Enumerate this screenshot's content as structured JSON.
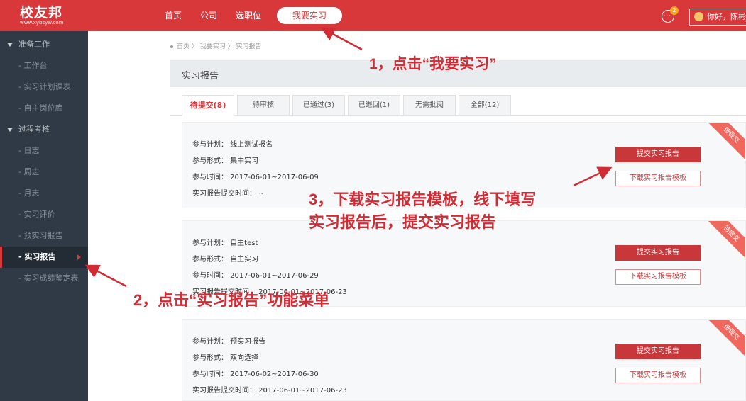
{
  "logo": {
    "main": "校友邦",
    "sub": "www.xybsyw.com"
  },
  "nav": {
    "items": [
      "首页",
      "公司",
      "选职位"
    ],
    "active": "我要实习"
  },
  "header_right": {
    "msg_badge": "2",
    "user_greeting": "你好，陈彬"
  },
  "sidebar": {
    "groups": [
      {
        "label": "准备工作",
        "items": [
          "- 工作台",
          "- 实习计划课表",
          "- 自主岗位库"
        ]
      },
      {
        "label": "过程考核",
        "items": [
          "- 日志",
          "- 周志",
          "- 月志",
          "- 实习评价",
          "- 预实习报告",
          "- 实习报告",
          "- 实习成绩鉴定表"
        ]
      }
    ],
    "active_item": "- 实习报告"
  },
  "breadcrumb": [
    "首页",
    "我要实习",
    "实习报告"
  ],
  "page_title": "实习报告",
  "tabs": [
    "待提交(8)",
    "待审核",
    "已通过(3)",
    "已退回(1)",
    "无需批阅",
    "全部(12)"
  ],
  "cards": [
    {
      "rows": [
        "参与计划：  线上测试报名",
        "参与形式：  集中实习",
        "参与时间：  2017-06-01~2017-06-09",
        "实习报告提交时间：  ~"
      ],
      "submit_label": "提交实习报告",
      "download_label": "下载实习报告模板",
      "ribbon": "待提交"
    },
    {
      "rows": [
        "参与计划：  自主test",
        "参与形式：  自主实习",
        "参与时间：  2017-06-01~2017-06-29",
        "实习报告提交时间：  2017-06-01~2017-06-23"
      ],
      "submit_label": "提交实习报告",
      "download_label": "下载实习报告模板",
      "ribbon": "待提交"
    },
    {
      "rows": [
        "参与计划：  预实习报告",
        "参与形式：  双向选择",
        "参与时间：  2017-06-02~2017-06-30",
        "实习报告提交时间：  2017-06-01~2017-06-23"
      ],
      "submit_label": "提交实习报告",
      "download_label": "下载实习报告模板",
      "ribbon": "待提交"
    }
  ],
  "annotations": {
    "step1": "1，点击“我要实习”",
    "step2": "2，点击“实习报告”功能菜单",
    "step3_line1": "3，下载实习报告模板，线下填写",
    "step3_line2": "实习报告后，提交实习报告"
  },
  "colors": {
    "brand_red": "#d9383b",
    "sidebar_bg": "#2f3a46",
    "annotation_red": "#d12b34"
  }
}
